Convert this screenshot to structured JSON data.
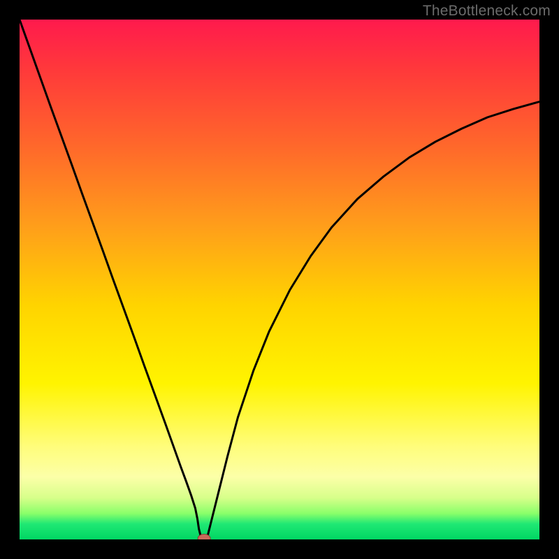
{
  "watermark": {
    "text": "TheBottleneck.com"
  },
  "colors": {
    "curve_stroke": "#000000",
    "marker_fill": "#C96A5A",
    "marker_stroke": "#8A3F32"
  },
  "chart_data": {
    "type": "line",
    "title": "",
    "xlabel": "",
    "ylabel": "",
    "xlim": [
      0,
      1
    ],
    "ylim": [
      0,
      1
    ],
    "x": [
      0.0,
      0.02,
      0.04,
      0.06,
      0.08,
      0.1,
      0.12,
      0.14,
      0.16,
      0.18,
      0.2,
      0.22,
      0.24,
      0.26,
      0.28,
      0.3,
      0.31,
      0.32,
      0.33,
      0.338,
      0.34,
      0.342,
      0.345,
      0.348,
      0.35,
      0.355,
      0.36,
      0.36,
      0.37,
      0.38,
      0.4,
      0.42,
      0.45,
      0.48,
      0.52,
      0.56,
      0.6,
      0.65,
      0.7,
      0.75,
      0.8,
      0.85,
      0.9,
      0.95,
      1.0
    ],
    "values": [
      1.0,
      0.944,
      0.888,
      0.832,
      0.777,
      0.722,
      0.666,
      0.611,
      0.556,
      0.5,
      0.445,
      0.39,
      0.334,
      0.279,
      0.224,
      0.168,
      0.14,
      0.113,
      0.085,
      0.06,
      0.05,
      0.04,
      0.02,
      0.008,
      0.005,
      0.003,
      0.0,
      0.0,
      0.04,
      0.08,
      0.16,
      0.235,
      0.325,
      0.4,
      0.48,
      0.545,
      0.6,
      0.655,
      0.698,
      0.735,
      0.765,
      0.79,
      0.812,
      0.828,
      0.842
    ],
    "marker": {
      "x": 0.355,
      "y": 0.002
    },
    "grid": false,
    "legend": false
  }
}
